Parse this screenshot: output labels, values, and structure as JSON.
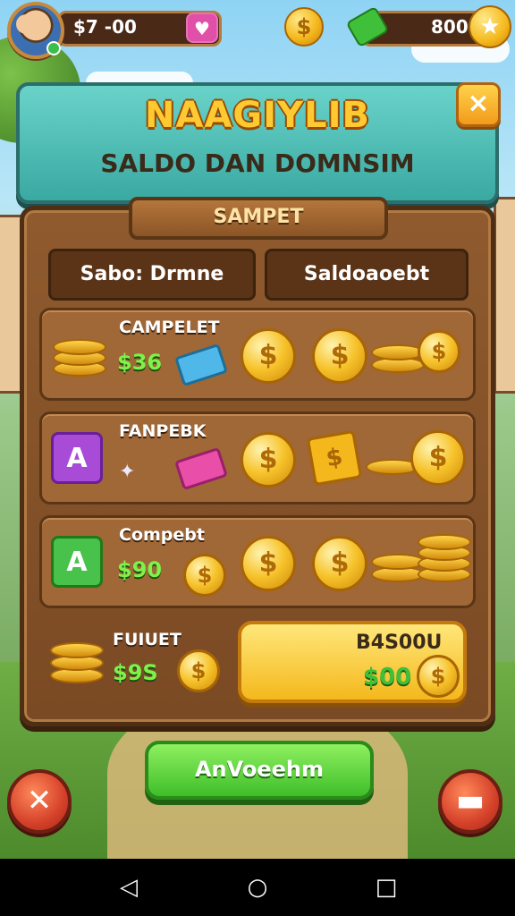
{
  "hud": {
    "cash": "$7 -00",
    "gems_icon": "heart-gem-icon",
    "coin_symbol": "$",
    "bills": "800",
    "star_icon": "star-icon"
  },
  "banner": {
    "title": "NAAGIYLIB",
    "subtitle": "SALDO DAN DOMNSIM",
    "close_label": "×"
  },
  "panel": {
    "sign": "SAMPET",
    "tabs": [
      "Sabo: Drmne",
      "Saldoaoebt"
    ]
  },
  "rows": [
    {
      "label": "CAMPELET",
      "price": "$36"
    },
    {
      "label": "FANPEBK",
      "price": ""
    },
    {
      "label": "Compebt",
      "price": "$90"
    },
    {
      "label": "FUIUET",
      "price": "$9S"
    }
  ],
  "buy": {
    "top": "B4S00U",
    "bottom": "$00"
  },
  "actions": {
    "confirm": "AnVoeehm",
    "back": "✕",
    "menu": "▬"
  },
  "nav": {
    "back": "◁",
    "home": "○",
    "recent": "□"
  },
  "colors": {
    "accent": "#f4b81c",
    "banner": "#3aa9a2",
    "wood": "#7a4a24",
    "green": "#3fbe2a"
  }
}
